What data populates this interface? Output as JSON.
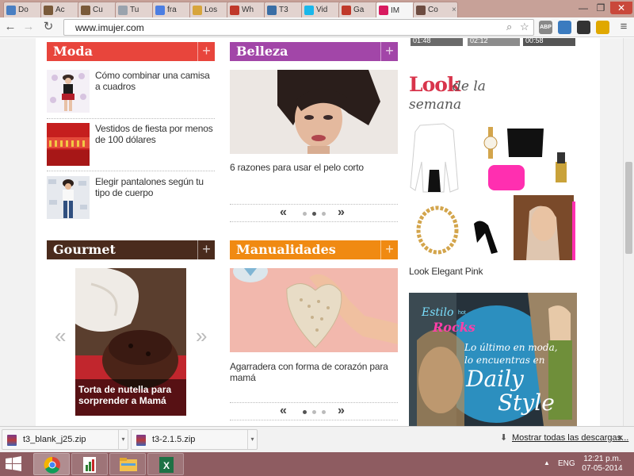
{
  "browser": {
    "tabs": [
      {
        "label": "Do",
        "favicon": "doc-icon",
        "color": "#4a7fc2"
      },
      {
        "label": "Ac",
        "favicon": "owl-icon",
        "color": "#7a5a3a"
      },
      {
        "label": "Cu",
        "favicon": "owl-icon",
        "color": "#7a5a3a"
      },
      {
        "label": "Tu",
        "favicon": "page-icon",
        "color": "#9aa3ad"
      },
      {
        "label": "fra",
        "favicon": "google-plus-icon",
        "color": "#4c7ee2"
      },
      {
        "label": "Los",
        "favicon": "folder-icon",
        "color": "#d7a53c"
      },
      {
        "label": "Wh",
        "favicon": "media-icon",
        "color": "#c0392b"
      },
      {
        "label": "T3",
        "favicon": "triangle-icon",
        "color": "#3a6ea5"
      },
      {
        "label": "Vid",
        "favicon": "vimeo-icon",
        "color": "#1ab7ea"
      },
      {
        "label": "Ga",
        "favicon": "media-icon",
        "color": "#c0392b"
      },
      {
        "label": "IM",
        "favicon": "imujer-icon",
        "color": "#d81b60",
        "active": true
      },
      {
        "label": "Co",
        "favicon": "cloud-icon",
        "color": "#6d4c41"
      }
    ],
    "close_glyph": "×",
    "window": {
      "minimize": "—",
      "maximize": "❐",
      "close": "✕"
    },
    "nav": {
      "back": "←",
      "forward": "→",
      "reload": "↻",
      "menu": "≡"
    },
    "url": "www.imujer.com",
    "extensions": [
      {
        "name": "abp-icon",
        "label": "ABP",
        "color": "#888888"
      },
      {
        "name": "avatar-ext-icon",
        "label": "",
        "color": "#3b7bbf"
      },
      {
        "name": "qr-ext-icon",
        "label": "",
        "color": "#333333"
      },
      {
        "name": "mail-ext-icon",
        "label": "",
        "color": "#e0a800"
      }
    ]
  },
  "page": {
    "videos": [
      "01:48",
      "02:12",
      "00:58"
    ],
    "col1": {
      "moda": {
        "title": "Moda",
        "color": "#e8453c",
        "stories": [
          "Cómo combinar una camisa a cuadros",
          "Vestidos de fiesta por menos de 100 dólares",
          "Elegir pantalones según tu tipo de cuerpo"
        ]
      },
      "gourmet": {
        "title": "Gourmet",
        "color": "#4a2b1d",
        "caption": "Torta de nutella para sorprender a Mamá",
        "prev": "«",
        "next": "»"
      }
    },
    "col2": {
      "belleza": {
        "title": "Belleza",
        "color": "#a246a8",
        "caption": "6 razones para usar el pelo corto",
        "prev": "«",
        "next": "»"
      },
      "manualidades": {
        "title": "Manualidades",
        "color": "#f08a12",
        "caption": "Agarradera con forma de corazón para mamá",
        "prev": "«",
        "next": "»"
      }
    },
    "col3": {
      "look_word": "Look",
      "look_rest": "de la",
      "look_week": "semana",
      "look_caption": "Look Elegant Pink",
      "ad": {
        "brand_top": "Estilo",
        "brand_small": "hot",
        "brand_bottom": "Rocks",
        "line1": "Lo último en moda,",
        "line2": "lo encuentras en",
        "big1": "Daily",
        "big2": "Style"
      }
    },
    "plus": "+"
  },
  "downloads": {
    "items": [
      "t3_blank_j25.zip",
      "t3-2.1.5.zip"
    ],
    "show_all": "Mostrar todas las descargas...",
    "close": "×"
  },
  "taskbar": {
    "apps": [
      "chrome-icon",
      "excel-chart-icon",
      "file-explorer-icon",
      "excel-icon"
    ],
    "lang": "ENG",
    "time": "12:21 p.m.",
    "date": "07-05-2014",
    "tray_up": "▲"
  }
}
